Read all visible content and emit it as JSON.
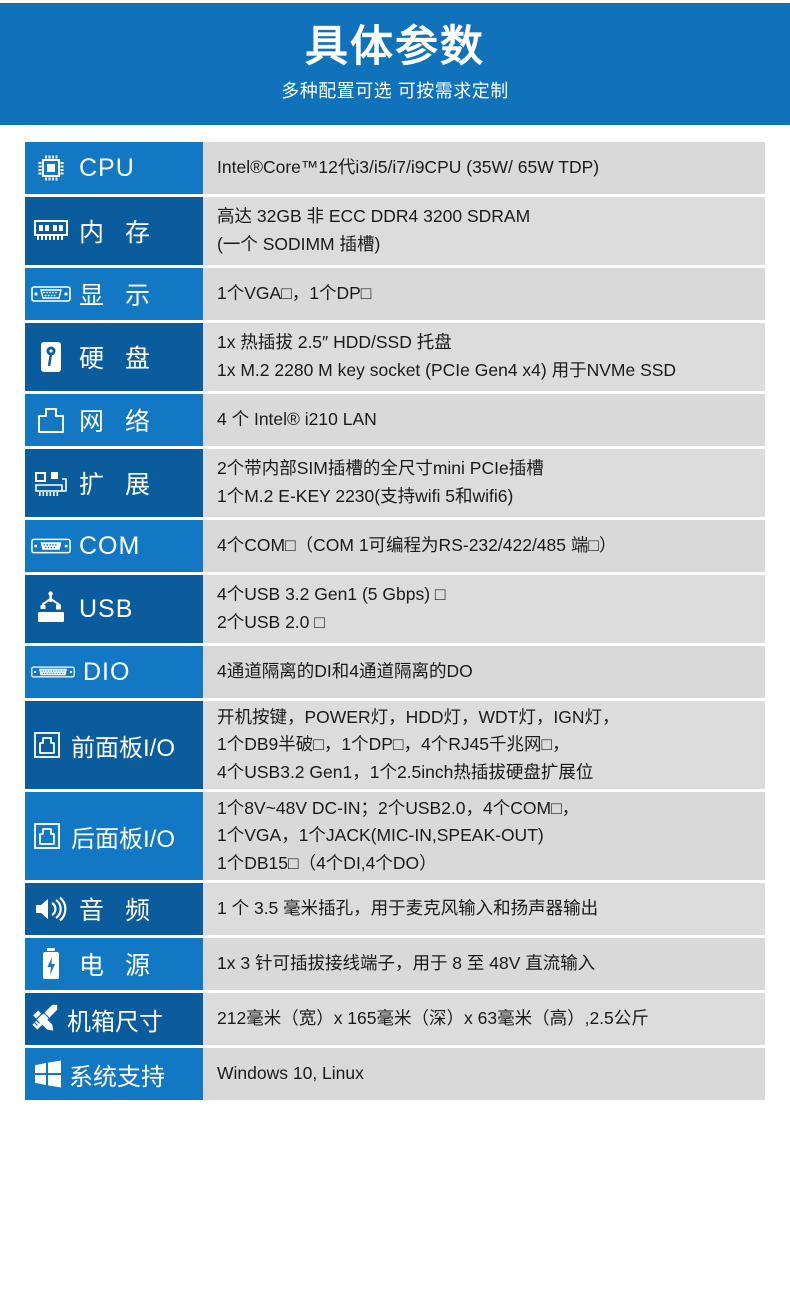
{
  "banner": {
    "title": "具体参数",
    "subtitle": "多种配置可选 可按需求定制"
  },
  "colors": {
    "banner_blue": "#0f72bb",
    "label_blue_light": "#1378c4",
    "label_blue_dark": "#0b5c9c",
    "value_gray": "#d9d9d9",
    "text_dark": "#1a1a1a",
    "text_white": "#ffffff"
  },
  "spec_rows": [
    {
      "label": "CPU",
      "icon": "cpu-chip-icon",
      "lines": [
        "Intel®Core™12代i3/i5/i7/i9CPU (35W/ 65W TDP)"
      ]
    },
    {
      "label": "内 存",
      "icon": "memory-module-icon",
      "lines": [
        "高达 32GB 非 ECC DDR4 3200 SDRAM",
        "(一个 SODIMM 插槽)"
      ]
    },
    {
      "label": "显 示",
      "icon": "vga-port-icon",
      "lines": [
        "1个VGA□，1个DP□"
      ]
    },
    {
      "label": "硬 盘",
      "icon": "hard-disk-icon",
      "lines": [
        "1x 热插拔 2.5″ HDD/SSD 托盘",
        "1x M.2 2280 M key socket (PCIe Gen4 x4) 用于NVMe SSD"
      ]
    },
    {
      "label": "网 络",
      "icon": "rj45-jack-icon",
      "lines": [
        "4 个 Intel® i210 LAN"
      ]
    },
    {
      "label": "扩 展",
      "icon": "expansion-card-icon",
      "lines": [
        "2个带内部SIM插槽的全尺寸mini PCIe插槽",
        "1个M.2 E-KEY 2230(支持wifi 5和wifi6)"
      ]
    },
    {
      "label": "COM",
      "icon": "db9-serial-port-icon",
      "lines": [
        "4个COM□（COM 1可编程为RS-232/422/485 端□）"
      ]
    },
    {
      "label": "USB",
      "icon": "usb-port-icon",
      "lines": [
        "4个USB 3.2 Gen1 (5 Gbps) □",
        "2个USB 2.0 □"
      ]
    },
    {
      "label": "DIO",
      "icon": "db25-connector-icon",
      "lines": [
        "4通道隔离的DI和4通道隔离的DO"
      ]
    },
    {
      "label": "前面板I/O",
      "icon": "panel-io-icon",
      "lines": [
        "开机按键，POWER灯，HDD灯，WDT灯，IGN灯，",
        "1个DB9半破□，1个DP□，4个RJ45千兆网□，",
        "4个USB3.2 Gen1，1个2.5inch热插拔硬盘扩展位"
      ]
    },
    {
      "label": "后面板I/O",
      "icon": "panel-io-icon",
      "lines": [
        "1个8V~48V DC-IN；2个USB2.0，4个COM□，",
        "1个VGA，1个JACK(MIC-IN,SPEAK-OUT)",
        "1个DB15□（4个DI,4个DO）"
      ]
    },
    {
      "label": "音 频",
      "icon": "speaker-icon",
      "lines": [
        "1 个 3.5 毫米插孔，用于麦克风输入和扬声器输出"
      ]
    },
    {
      "label": "电 源",
      "icon": "battery-power-icon",
      "lines": [
        "1x 3 针可插拔接线端子，用于 8 至 48V 直流输入"
      ]
    },
    {
      "label": "机箱尺寸",
      "icon": "ruler-pencil-icon",
      "lines": [
        "212毫米（宽）x 165毫米（深）x 63毫米（高）,2.5公斤"
      ]
    },
    {
      "label": "系统支持",
      "icon": "windows-logo-icon",
      "lines": [
        "Windows 10, Linux"
      ]
    }
  ]
}
